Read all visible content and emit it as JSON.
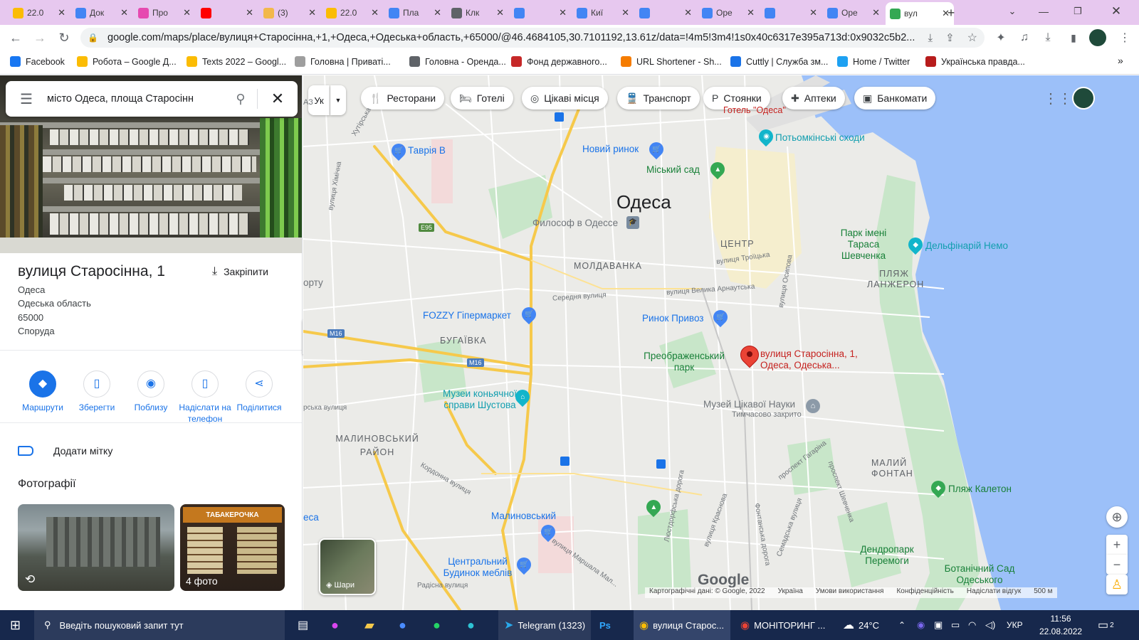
{
  "browser": {
    "tabs": [
      {
        "title": "22.0",
        "icon_color": "#fbbc04",
        "icon": "drive-icon"
      },
      {
        "title": "Док",
        "icon_color": "#4285f4",
        "icon": "docs-icon"
      },
      {
        "title": "Про",
        "icon_color": "#e64ab0",
        "icon": "app-icon"
      },
      {
        "title": "",
        "icon_color": "#ff0000",
        "icon": "youtube-icon"
      },
      {
        "title": "(3) ",
        "icon_color": "#f2b84b",
        "icon": "app-icon"
      },
      {
        "title": "22.0",
        "icon_color": "#fbbc04",
        "icon": "drive-icon"
      },
      {
        "title": "Пла",
        "icon_color": "#4285f4",
        "icon": "docs-icon"
      },
      {
        "title": "Клк",
        "icon_color": "#5f6368",
        "icon": "shield-icon"
      },
      {
        "title": "",
        "icon_color": "#4285f4",
        "icon": "docs-icon"
      },
      {
        "title": "Киї",
        "icon_color": "#4285f4",
        "icon": "docs-icon"
      },
      {
        "title": "",
        "icon_color": "#4285f4",
        "icon": "docs-icon"
      },
      {
        "title": "Оре",
        "icon_color": "#4285f4",
        "icon": "docs-icon"
      },
      {
        "title": "",
        "icon_color": "#4285f4",
        "icon": "docs-icon"
      },
      {
        "title": "Оре",
        "icon_color": "#4285f4",
        "icon": "docs-icon"
      },
      {
        "title": "вул",
        "icon_color": "#34a853",
        "icon": "maps-icon",
        "active": true
      }
    ],
    "url": "google.com/maps/place/вулиця+Старосінна,+1,+Одеса,+Одеська+область,+65000/@46.4684105,30.7101192,13.61z/data=!4m5!3m4!1s0x40c6317e395a713d:0x9032c5b2...",
    "bookmarks": [
      {
        "label": "Facebook",
        "icon_color": "#1877f2"
      },
      {
        "label": "Робота – Google Д...",
        "icon_color": "#fbbc04"
      },
      {
        "label": "Texts 2022 – Googl...",
        "icon_color": "#fbbc04"
      },
      {
        "label": "Головна | Приваті...",
        "icon_color": "#9e9e9e"
      },
      {
        "label": "Головна - Оренда...",
        "icon_color": "#5f6368"
      },
      {
        "label": "Фонд державного...",
        "icon_color": "#c62828"
      },
      {
        "label": "URL Shortener - Sh...",
        "icon_color": "#f57c00"
      },
      {
        "label": "Cuttly | Служба зм...",
        "icon_color": "#1a73e8"
      },
      {
        "label": "Home / Twitter",
        "icon_color": "#1da1f2"
      },
      {
        "label": "Українська правда...",
        "icon_color": "#b71c1c"
      }
    ]
  },
  "panel": {
    "search_query": "місто Одеса, площа Старосінн",
    "title": "вулиця Старосінна, 1",
    "pin_label": "Закріпити",
    "address_lines": [
      "Одеса",
      "Одеська область",
      "65000",
      "Споруда"
    ],
    "actions": [
      {
        "label": "Маршрути",
        "icon": "directions-icon",
        "primary": true
      },
      {
        "label": "Зберегти",
        "icon": "bookmark-icon"
      },
      {
        "label": "Поблизу",
        "icon": "nearby-icon"
      },
      {
        "label": "Надіслати на телефон",
        "icon": "send-to-phone-icon"
      },
      {
        "label": "Поділитися",
        "icon": "share-icon"
      }
    ],
    "add_label": "Додати мітку",
    "photos_heading": "Фотографії",
    "photo2_sign": "ТАБАКЕРОЧКА",
    "photo2_caption": "4 фото"
  },
  "map": {
    "lang_button": "Ук",
    "chips": [
      {
        "label": "Ресторани",
        "icon": "restaurant-icon",
        "glyph": "🍴"
      },
      {
        "label": "Готелі",
        "icon": "hotel-icon",
        "glyph": "🛏"
      },
      {
        "label": "Цікаві місця",
        "icon": "attraction-icon",
        "glyph": "◎"
      },
      {
        "label": "Транспорт",
        "icon": "transit-icon",
        "glyph": "🚆"
      },
      {
        "label": "Стоянки",
        "icon": "parking-icon",
        "glyph": "P"
      },
      {
        "label": "Аптеки",
        "icon": "pharmacy-icon",
        "glyph": "✚"
      },
      {
        "label": "Банкомати",
        "icon": "atm-icon",
        "glyph": "▣"
      }
    ],
    "city_label": "Одеса",
    "districts": [
      "МОЛДАВАНКА",
      "ЦЕНТР",
      "ПЛЯЖ ЛАНЖЕРОН",
      "БУГАЇВКА",
      "МАЛИНОВСЬКИЙ РАЙОН",
      "МАЛИЙ ФОНТАН"
    ],
    "places": {
      "tavria": "Таврія В",
      "noviy_rinok": "Новий ринок",
      "miskiy_sad": "Міський сад",
      "potemkin": "Потьомкінські сходи",
      "hotel": "Готель \"Одеса\"",
      "filosof": "Философ в Одессе",
      "park_shevchenka": "Парк імені Тараса Шевченка",
      "delfinarium": "Дельфінарій Немо",
      "fozzy": "FOZZY Гіпермаркет",
      "privoz": "Ринок Привоз",
      "preobrazh": "Преображенський парк",
      "selected": "вулиця Старосінна, 1, Одеса, Одеська...",
      "muzei_nauky": "Музей Цікавої Науки",
      "muzei_status": "Тимчасово закрито",
      "muzei_konyak": "Музеи коньячної справи Шустова",
      "malinovskiy": "Малиновський",
      "budynok": "Центральний Будинок меблів",
      "plyazh_kaleton": "Пляж Калетон",
      "dendropark": "Дендропарк Перемоги",
      "botanic": "Ботанічний Сад Одеського Національного"
    },
    "streets": [
      "вулиця Хімічна",
      "Хутірська",
      "Середня вулиця",
      "вулиця Велика Арнаутська",
      "вулиця Троїцька",
      "вулиця Осипова",
      "Кордонна вулиця",
      "вулиця Маршала Мал...",
      "Радісна вулиця",
      "Люстдорфська дорога",
      "вулиця Краснова",
      "Фонтанська дорога",
      "Семадська вулиця",
      "проспект Гагаріна",
      "проспект Шевченка"
    ],
    "road_badges": [
      "E95",
      "M16",
      "M16"
    ],
    "edge_labels": [
      "орту",
      "рська вулиця",
      "еса",
      "АЗ"
    ],
    "layers_label": "Шари",
    "footer": [
      "Картографічні дані: © Google, 2022",
      "Україна",
      "Умови використання",
      "Конфіденційність",
      "Надіслати відгук",
      "500 м"
    ],
    "google_logo": "Google"
  },
  "taskbar": {
    "search_placeholder": "Введіть пошуковий запит тут",
    "telegram": "Telegram (1323)",
    "telegram_badge": "23",
    "chrome_window": "вулиця Старос...",
    "chrome_window2": "МОНІТОРИНГ ...",
    "temperature": "24°C",
    "lang": "УКР",
    "time": "11:56",
    "date": "22.08.2022",
    "notif_count": "2"
  }
}
